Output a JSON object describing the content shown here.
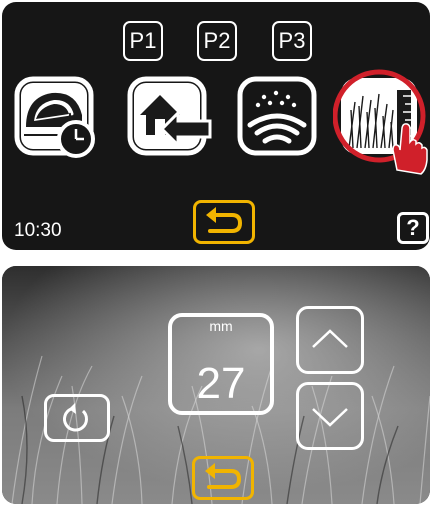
{
  "top_screen": {
    "presets": [
      {
        "label": "P1"
      },
      {
        "label": "P2"
      },
      {
        "label": "P3"
      }
    ],
    "tiles": [
      {
        "icon": "mower-schedule-icon"
      },
      {
        "icon": "home-return-icon"
      },
      {
        "icon": "rain-sensor-icon"
      },
      {
        "icon": "cutting-height-icon",
        "highlighted": true
      }
    ],
    "time": "10:30",
    "help_label": "?",
    "back_icon": "return-arrow-icon",
    "highlight_color": "#d0202a",
    "accent_color": "#f1b400"
  },
  "bottom_screen": {
    "unit_label": "mm",
    "cutting_height": "27",
    "reset_icon": "refresh-icon",
    "up_icon": "chevron-up-icon",
    "down_icon": "chevron-down-icon",
    "back_icon": "return-arrow-icon"
  }
}
